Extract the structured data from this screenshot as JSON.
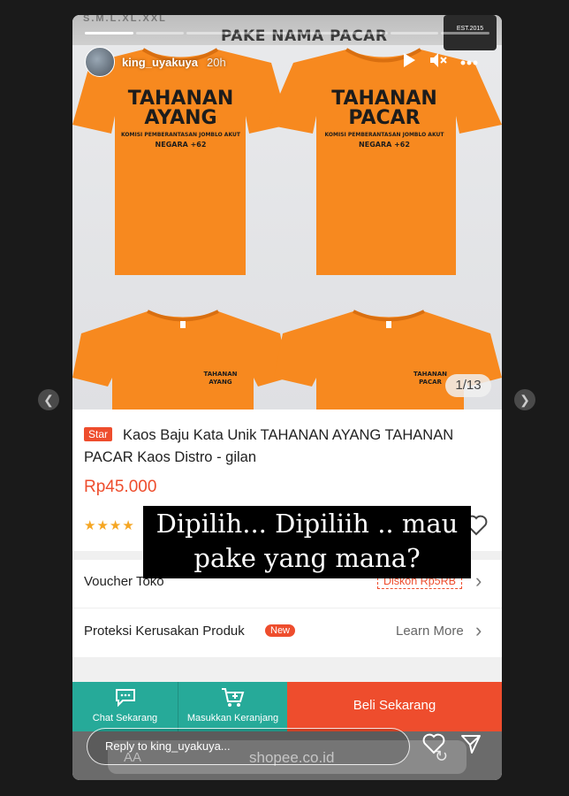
{
  "story": {
    "username": "king_uyakuya",
    "time_ago": "20h",
    "reply_placeholder": "Reply to king_uyakuya...",
    "progress_segments": 8,
    "progress_done": 1
  },
  "photo": {
    "sizes": "S.M.L.XL.XXL",
    "banner_title": "PAKE NAMA PACAR",
    "logo_text": "EST.2015",
    "shirts": [
      {
        "line1": "TAHANAN",
        "line2": "AYANG",
        "line3": "KOMISI PEMBERANTASAN JOMBLO AKUT",
        "line4": "NEGARA +62"
      },
      {
        "line1": "TAHANAN",
        "line2": "PACAR",
        "line3": "KOMISI PEMBERANTASAN JOMBLO AKUT",
        "line4": "NEGARA +62"
      },
      {
        "line1": "TAHANAN",
        "line2": "AYANG"
      },
      {
        "line1": "TAHANAN",
        "line2": "PACAR"
      }
    ],
    "page_indicator": "1/13"
  },
  "product": {
    "badge": "Star",
    "title": "Kaos Baju Kata Unik TAHANAN AYANG TAHANAN PACAR Kaos Distro - gilan",
    "price": "Rp45.000",
    "stars": "★★★★"
  },
  "caption": {
    "line1": "Dipilih... Dipiliih .. mau",
    "line2": "pake yang mana?"
  },
  "rows": {
    "voucher_label": "Voucher Toko",
    "voucher_tag": "Diskon Rp5RB",
    "protection_label": "Proteksi Kerusakan Produk",
    "new_badge": "New",
    "learn_more": "Learn More"
  },
  "bottom": {
    "chat": "Chat Sekarang",
    "cart": "Masukkan Keranjang",
    "buy": "Beli Sekarang"
  },
  "browser": {
    "aa": "AA",
    "url": "shopee.co.id"
  },
  "colors": {
    "shopee_orange": "#ee4d2d",
    "teal": "#26aa99",
    "shirt": "#f7891f"
  }
}
